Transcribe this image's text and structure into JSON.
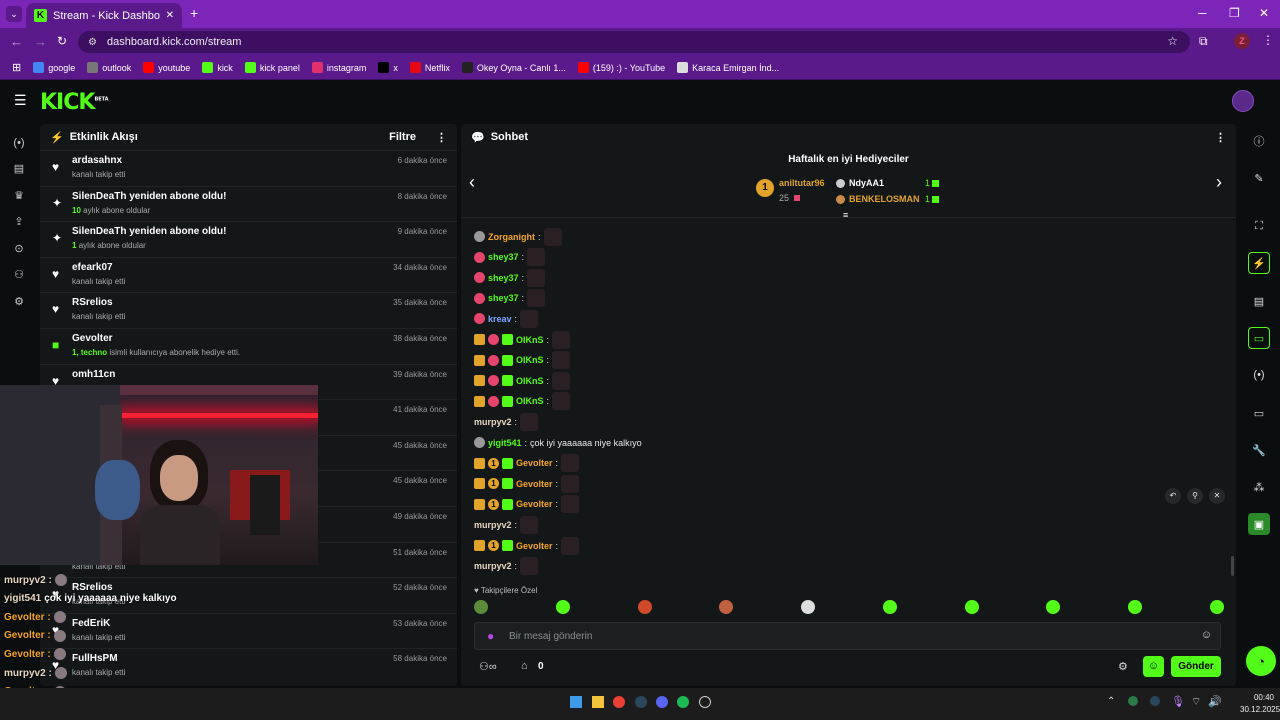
{
  "browser": {
    "tab_title": "Stream - Kick Dashboard",
    "new_tab": "+",
    "url": "dashboard.kick.com/stream",
    "profile": "Z",
    "bookmarks": [
      {
        "label": "google",
        "color": "#4285f4"
      },
      {
        "label": "outlook",
        "color": "#777777"
      },
      {
        "label": "youtube",
        "color": "#ff0000"
      },
      {
        "label": "kick",
        "color": "#53fc18"
      },
      {
        "label": "kick panel",
        "color": "#53fc18"
      },
      {
        "label": "instagram",
        "color": "#e1306c"
      },
      {
        "label": "x",
        "color": "#000000"
      },
      {
        "label": "Netflix",
        "color": "#e50914"
      },
      {
        "label": "Okey Oyna - Canlı 1...",
        "color": "#222222"
      },
      {
        "label": "(159) :) - YouTube",
        "color": "#ff0000"
      },
      {
        "label": "Karaca Emirgan İnd...",
        "color": "#dddddd"
      }
    ]
  },
  "app": {
    "logo": "KICK",
    "logo_sup": "BETA",
    "accent": "#53fc18"
  },
  "events": {
    "title": "Etkinlik Akışı",
    "filter": "Filtre",
    "items": [
      {
        "icon": "heart-icon",
        "glyph": "♥",
        "title": "ardasahnx",
        "sub": "kanalı takip etti",
        "time": "6 dakika önce"
      },
      {
        "icon": "sparkle-icon",
        "glyph": "✦",
        "title": "SilenDeaTh yeniden abone oldu!",
        "sub_num": "10",
        "sub": "aylık abone oldular",
        "time": "8 dakika önce"
      },
      {
        "icon": "sparkle-icon",
        "glyph": "✦",
        "title": "SilenDeaTh yeniden abone oldu!",
        "sub_num": "1",
        "sub": "aylık abone oldular",
        "time": "9 dakika önce"
      },
      {
        "icon": "heart-icon",
        "glyph": "♥",
        "title": "efeark07",
        "sub": "kanalı takip etti",
        "time": "34 dakika önce"
      },
      {
        "icon": "heart-icon",
        "glyph": "♥",
        "title": "RSrelios",
        "sub": "kanalı takip etti",
        "time": "35 dakika önce"
      },
      {
        "icon": "gift-icon",
        "glyph": "■",
        "title": "Gevolter",
        "sub_num": "1, techno",
        "sub": "isimli kullanıcıya abonelik hediye etti.",
        "time": "38 dakika önce"
      },
      {
        "icon": "heart-icon",
        "glyph": "♥",
        "title": "omh11cn",
        "sub": "",
        "time": "39 dakika önce"
      },
      {
        "icon": "heart-icon",
        "glyph": "♥",
        "title": "",
        "sub": "",
        "time": "41 dakika önce"
      },
      {
        "icon": "heart-icon",
        "glyph": "♥",
        "title": "",
        "sub": "",
        "time": "45 dakika önce"
      },
      {
        "icon": "heart-icon",
        "glyph": "♥",
        "title": "",
        "sub": "",
        "time": "45 dakika önce"
      },
      {
        "icon": "heart-icon",
        "glyph": "♥",
        "title": "",
        "sub": "",
        "time": "49 dakika önce"
      },
      {
        "icon": "heart-icon",
        "glyph": "♥",
        "title": "",
        "sub": "kanalı takip etti",
        "time": "51 dakika önce"
      },
      {
        "icon": "heart-icon",
        "glyph": "♥",
        "title": "RSrelios",
        "sub": "kanalı takip etti",
        "time": "52 dakika önce"
      },
      {
        "icon": "heart-icon",
        "glyph": "♥",
        "title": "FedEriK",
        "sub": "kanalı takip etti",
        "time": "53 dakika önce"
      },
      {
        "icon": "heart-icon",
        "glyph": "♥",
        "title": "FullHsPM",
        "sub": "kanalı takip etti",
        "time": "58 dakika önce"
      }
    ]
  },
  "chat": {
    "title": "Sohbet",
    "gifters_title": "Haftalık en iyi Hediyeciler",
    "top_gifter": {
      "rank": "1",
      "name": "aniltutar96",
      "count": "25"
    },
    "gifter2": {
      "name": "NdyAA1",
      "count": "1"
    },
    "gifter3": {
      "name": "BENKELOSMAN",
      "count": "1"
    },
    "lines": [
      {
        "user": "Zorganight",
        "color": "#f5a623",
        "badges": [
          "cat"
        ],
        "text": ""
      },
      {
        "user": "shey37",
        "color": "#53fc18",
        "badges": [
          "devil"
        ],
        "text": ""
      },
      {
        "user": "shey37",
        "color": "#53fc18",
        "badges": [
          "devil"
        ],
        "text": ""
      },
      {
        "user": "shey37",
        "color": "#53fc18",
        "badges": [
          "devil"
        ],
        "text": ""
      },
      {
        "user": "kreav",
        "color": "#7ba7ff",
        "badges": [
          "devil"
        ],
        "text": ""
      },
      {
        "user": "OIKnS",
        "color": "#53fc18",
        "badges": [
          "crown",
          "devil",
          "sub"
        ],
        "text": ""
      },
      {
        "user": "OIKnS",
        "color": "#53fc18",
        "badges": [
          "crown",
          "devil",
          "sub"
        ],
        "text": ""
      },
      {
        "user": "OIKnS",
        "color": "#53fc18",
        "badges": [
          "crown",
          "devil",
          "sub"
        ],
        "text": ""
      },
      {
        "user": "OIKnS",
        "color": "#53fc18",
        "badges": [
          "crown",
          "devil",
          "sub"
        ],
        "text": ""
      },
      {
        "user": "murpyv2",
        "color": "#e8d5c0",
        "badges": [],
        "text": ""
      },
      {
        "user": "yigit541",
        "color": "#53fc18",
        "badges": [
          "cat"
        ],
        "text": "çok iyi yaaaaaa niye kalkıyo"
      },
      {
        "user": "Gevolter",
        "color": "#f5a623",
        "badges": [
          "crown",
          "num1",
          "sub"
        ],
        "text": ""
      },
      {
        "user": "Gevolter",
        "color": "#f5a623",
        "badges": [
          "crown",
          "num1",
          "sub"
        ],
        "text": ""
      },
      {
        "user": "Gevolter",
        "color": "#f5a623",
        "badges": [
          "crown",
          "num1",
          "sub"
        ],
        "text": ""
      },
      {
        "user": "murpyv2",
        "color": "#e8d5c0",
        "badges": [],
        "text": ""
      },
      {
        "user": "Gevolter",
        "color": "#f5a623",
        "badges": [
          "crown",
          "num1",
          "sub"
        ],
        "text": ""
      },
      {
        "user": "murpyv2",
        "color": "#e8d5c0",
        "badges": [],
        "text": ""
      }
    ],
    "followers_only": "Takipçilere Özel",
    "input_placeholder": "Bir mesaj gönderin",
    "viewer_count": "0",
    "send": "Gönder"
  },
  "overlay_chat": [
    {
      "user": "murpyv2 :",
      "text": ""
    },
    {
      "user": "yigit541",
      "text": "çok iyi yaaaaaa niye kalkıyo"
    },
    {
      "user": "Gevolter :",
      "text": ""
    },
    {
      "user": "Gevolter :",
      "text": ""
    },
    {
      "user": "Gevolter :",
      "text": ""
    },
    {
      "user": "murpyv2 :",
      "text": ""
    },
    {
      "user": "Gevolter :",
      "text": ""
    },
    {
      "user": "murpyv2 :",
      "text": ""
    }
  ],
  "taskbar": {
    "time": "00:40",
    "date": "30.12.2025"
  }
}
